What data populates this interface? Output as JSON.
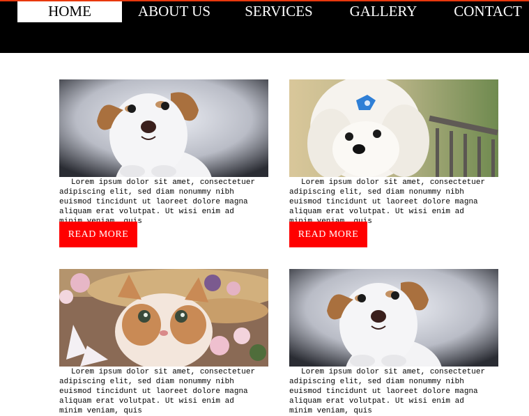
{
  "nav": {
    "items": [
      {
        "label": "HOME",
        "active": true
      },
      {
        "label": "ABOUT US",
        "active": false
      },
      {
        "label": "SERVICES",
        "active": false
      },
      {
        "label": "GALLERY",
        "active": false
      },
      {
        "label": "CONTACT",
        "active": false
      }
    ]
  },
  "cards": [
    {
      "photo": "dog-photo",
      "text": "Lorem ipsum dolor sit amet, consectetuer adipiscing elit, sed diam nonummy nibh euismod tincidunt ut laoreet dolore magna aliquam erat volutpat. Ut wisi enim ad minim veniam, quis",
      "button": "READ MORE"
    },
    {
      "photo": "white-puppy-photo",
      "text": "Lorem ipsum dolor sit amet, consectetuer adipiscing elit, sed diam nonummy nibh euismod tincidunt ut laoreet dolore magna aliquam erat volutpat. Ut wisi enim ad minim veniam, quis",
      "button": "READ MORE"
    },
    {
      "photo": "kitten-photo",
      "text": "Lorem ipsum dolor sit amet, consectetuer adipiscing elit, sed diam nonummy nibh euismod tincidunt ut laoreet dolore magna aliquam erat volutpat. Ut wisi enim ad minim veniam, quis"
    },
    {
      "photo": "dog-photo",
      "text": "Lorem ipsum dolor sit amet, consectetuer adipiscing elit, sed diam nonummy nibh euismod tincidunt ut laoreet dolore magna aliquam erat volutpat. Ut wisi enim ad minim veniam, quis"
    }
  ],
  "colors": {
    "header_bg": "#000000",
    "header_accent": "#e8380d",
    "button_bg": "#ff0000",
    "button_text": "#ffffff"
  }
}
